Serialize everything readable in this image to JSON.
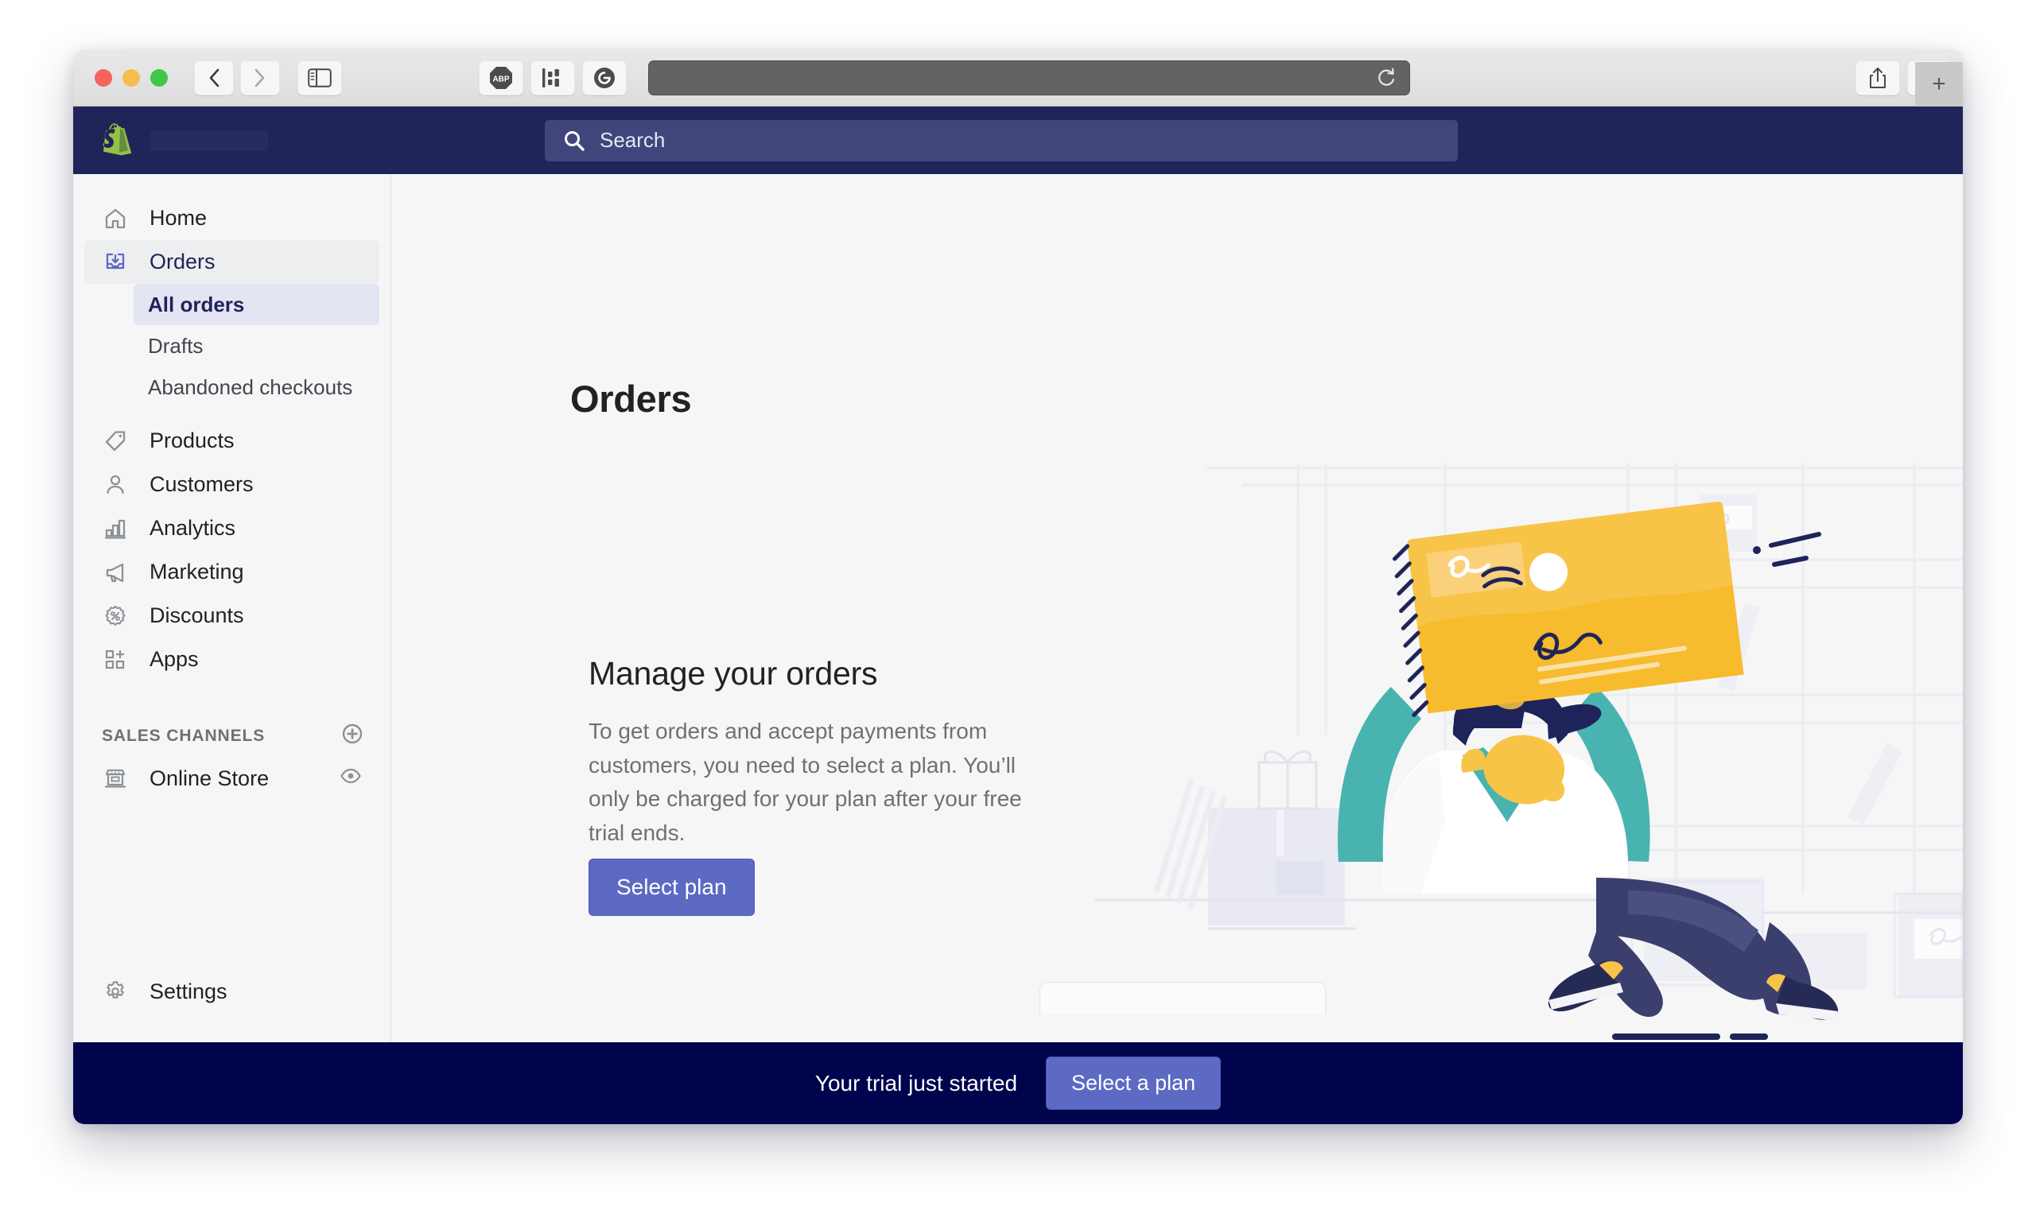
{
  "browser": {
    "traffic_lights": [
      "close",
      "minimize",
      "zoom"
    ],
    "back_label": "Back",
    "forward_label": "Forward",
    "sidebar_toggle_label": "Show sidebar",
    "extensions": [
      {
        "name": "adblock-plus",
        "label": "ABP"
      },
      {
        "name": "honey",
        "label": ""
      },
      {
        "name": "grammarly",
        "label": "G"
      }
    ],
    "address_value": "",
    "address_placeholder": "",
    "reload_label": "Reload",
    "share_label": "Share",
    "tab_overview_label": "Show tab overview",
    "new_tab_label": "+"
  },
  "topbar": {
    "logo_name": "shopify-logo",
    "store_name": "",
    "search": {
      "placeholder": "Search",
      "value": ""
    }
  },
  "sidebar": {
    "items": [
      {
        "label": "Home",
        "icon": "home-icon",
        "active": false
      },
      {
        "label": "Orders",
        "icon": "orders-icon",
        "active": true
      },
      {
        "label": "Products",
        "icon": "products-icon",
        "active": false
      },
      {
        "label": "Customers",
        "icon": "customers-icon",
        "active": false
      },
      {
        "label": "Analytics",
        "icon": "analytics-icon",
        "active": false
      },
      {
        "label": "Marketing",
        "icon": "marketing-icon",
        "active": false
      },
      {
        "label": "Discounts",
        "icon": "discounts-icon",
        "active": false
      },
      {
        "label": "Apps",
        "icon": "apps-icon",
        "active": false
      }
    ],
    "orders_subitems": [
      {
        "label": "All orders",
        "selected": true
      },
      {
        "label": "Drafts",
        "selected": false
      },
      {
        "label": "Abandoned checkouts",
        "selected": false
      }
    ],
    "sales_channels": {
      "heading": "SALES CHANNELS",
      "add_label": "Add sales channel",
      "items": [
        {
          "label": "Online Store",
          "icon": "storefront-icon",
          "action_icon": "eye-icon"
        }
      ]
    },
    "settings": {
      "label": "Settings",
      "icon": "gear-icon"
    }
  },
  "main": {
    "page_title": "Orders",
    "empty_state": {
      "heading": "Manage your orders",
      "body": "To get orders and accept payments from customers, you need to select a plan. You’ll only be charged for your plan after your free trial ends.",
      "button_label": "Select plan"
    },
    "illustration_name": "person-holding-envelope-illustration"
  },
  "trial_banner": {
    "message": "Your trial just started",
    "button_label": "Select a plan"
  },
  "colors": {
    "topbar_navy": "#1f2459",
    "banner_navy": "#00044d",
    "accent_indigo": "#5c6ac4",
    "sidebar_bg": "#f6f6f7",
    "selected_subitem_bg": "#e4e5f3",
    "shopify_green": "#95bf47"
  }
}
